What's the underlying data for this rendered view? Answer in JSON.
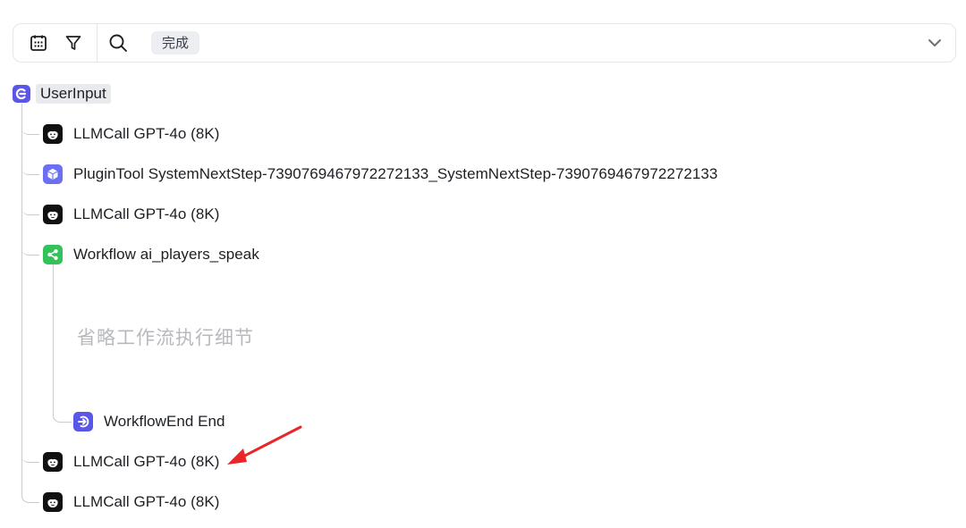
{
  "filterbar": {
    "calendar_icon": "calendar-icon",
    "filter_icon": "filter-icon",
    "search_icon": "search-icon",
    "status_tag": "完成",
    "expand_icon": "chevron-down-icon"
  },
  "tree": {
    "root": {
      "label": "UserInput",
      "icon": "user-input-icon"
    },
    "children": [
      {
        "label": "LLMCall GPT-4o (8K)",
        "icon": "llm-avatar-icon"
      },
      {
        "label": "PluginTool SystemNextStep-7390769467972272133_SystemNextStep-7390769467972272133",
        "icon": "plugin-cube-icon"
      },
      {
        "label": "LLMCall GPT-4o (8K)",
        "icon": "llm-avatar-icon"
      },
      {
        "label": "Workflow ai_players_speak",
        "icon": "workflow-share-icon"
      },
      {
        "label": "LLMCall GPT-4o (8K)",
        "icon": "llm-avatar-icon"
      },
      {
        "label": "LLMCall GPT-4o (8K)",
        "icon": "llm-avatar-icon"
      }
    ],
    "workflow_children": [
      {
        "label": "WorkflowEnd End",
        "icon": "workflow-end-icon"
      }
    ],
    "omitted_note": "省略工作流执行细节"
  },
  "colors": {
    "llm": "#111111",
    "plugin": "#6b6ff0",
    "workflow": "#33c15a",
    "end": "#5a57e8",
    "annotation_arrow": "#e8262a"
  }
}
